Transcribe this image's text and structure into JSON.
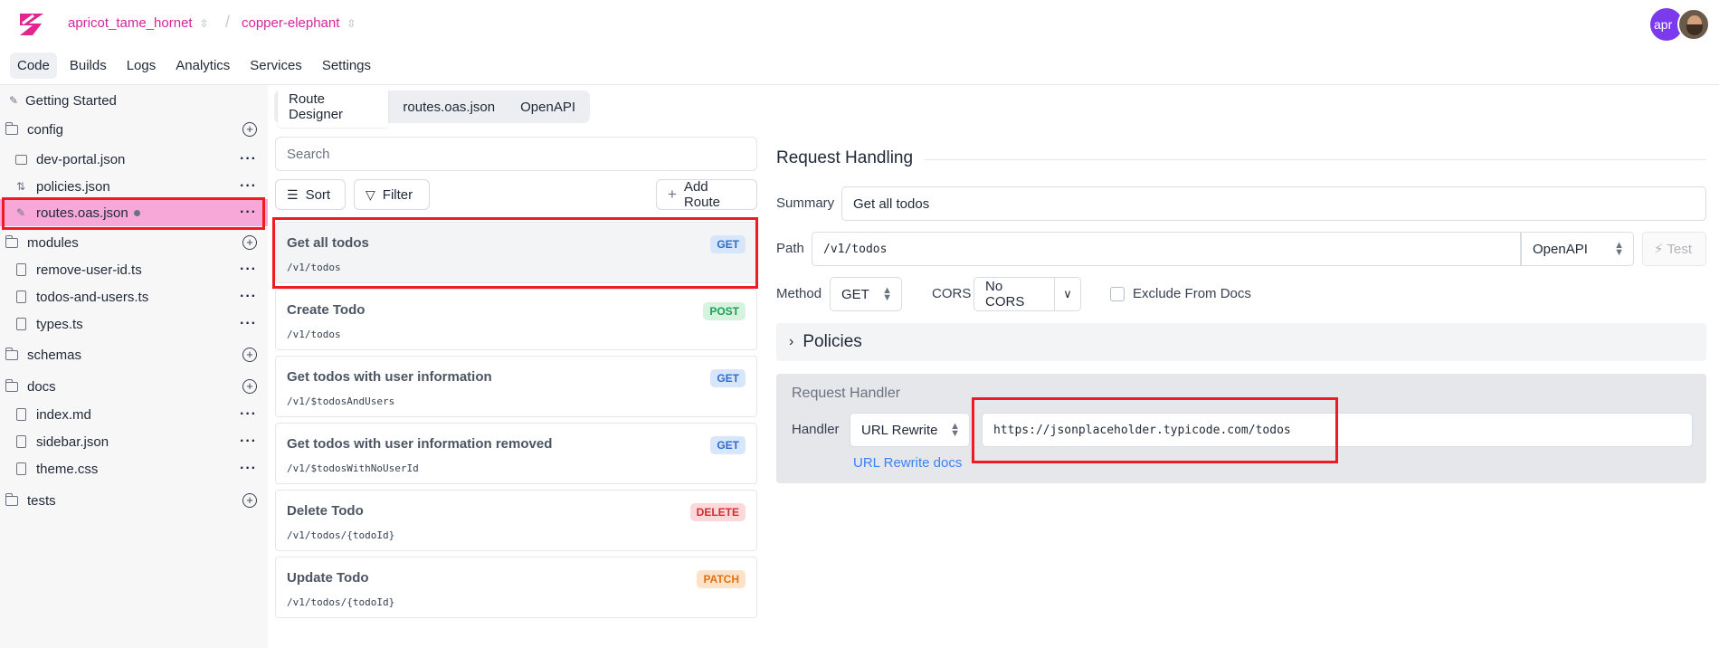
{
  "header": {
    "project": "apricot_tame_hornet",
    "environment": "copper-elephant",
    "separator": "/",
    "avatar_text": "apr"
  },
  "nav": {
    "items": [
      "Code",
      "Builds",
      "Logs",
      "Analytics",
      "Services",
      "Settings"
    ]
  },
  "sidebar": {
    "getting_started": "Getting Started",
    "folders": {
      "config": "config",
      "modules": "modules",
      "schemas": "schemas",
      "docs": "docs",
      "tests": "tests"
    },
    "files": {
      "dev_portal": "dev-portal.json",
      "policies": "policies.json",
      "routes": "routes.oas.json",
      "remove_user_id": "remove-user-id.ts",
      "todos_and_users": "todos-and-users.ts",
      "types": "types.ts",
      "index": "index.md",
      "sidebar": "sidebar.json",
      "theme": "theme.css"
    },
    "more": "···",
    "plus": "+"
  },
  "tabs": [
    "Route Designer",
    "routes.oas.json",
    "OpenAPI"
  ],
  "search": {
    "placeholder": "Search"
  },
  "toolbar": {
    "sort": "Sort",
    "filter": "Filter",
    "add_route": "Add Route"
  },
  "routes": [
    {
      "title": "Get all todos",
      "path": "/v1/todos",
      "method": "GET"
    },
    {
      "title": "Create Todo",
      "path": "/v1/todos",
      "method": "POST"
    },
    {
      "title": "Get todos with user information",
      "path": "/v1/$todosAndUsers",
      "method": "GET"
    },
    {
      "title": "Get todos with user information removed",
      "path": "/v1/$todosWithNoUserId",
      "method": "GET"
    },
    {
      "title": "Delete Todo",
      "path": "/v1/todos/{todoId}",
      "method": "DELETE"
    },
    {
      "title": "Update Todo",
      "path": "/v1/todos/{todoId}",
      "method": "PATCH"
    }
  ],
  "request": {
    "title": "Request Handling",
    "summary_label": "Summary",
    "summary_value": "Get all todos",
    "path_label": "Path",
    "path_value": "/v1/todos",
    "path_mode": "OpenAPI",
    "test": "Test",
    "method_label": "Method",
    "method_value": "GET",
    "cors_label": "CORS",
    "cors_value": "No CORS",
    "exclude_label": "Exclude From Docs",
    "policies": "Policies",
    "handler_title": "Request Handler",
    "handler_label": "Handler",
    "handler_value": "URL Rewrite",
    "rewrite_url": "https://jsonplaceholder.typicode.com/todos",
    "rewrite_docs": "URL Rewrite docs"
  },
  "colors": {
    "brand": "#d6249f",
    "highlight": "#ef1b24",
    "link": "#3b82f6"
  }
}
